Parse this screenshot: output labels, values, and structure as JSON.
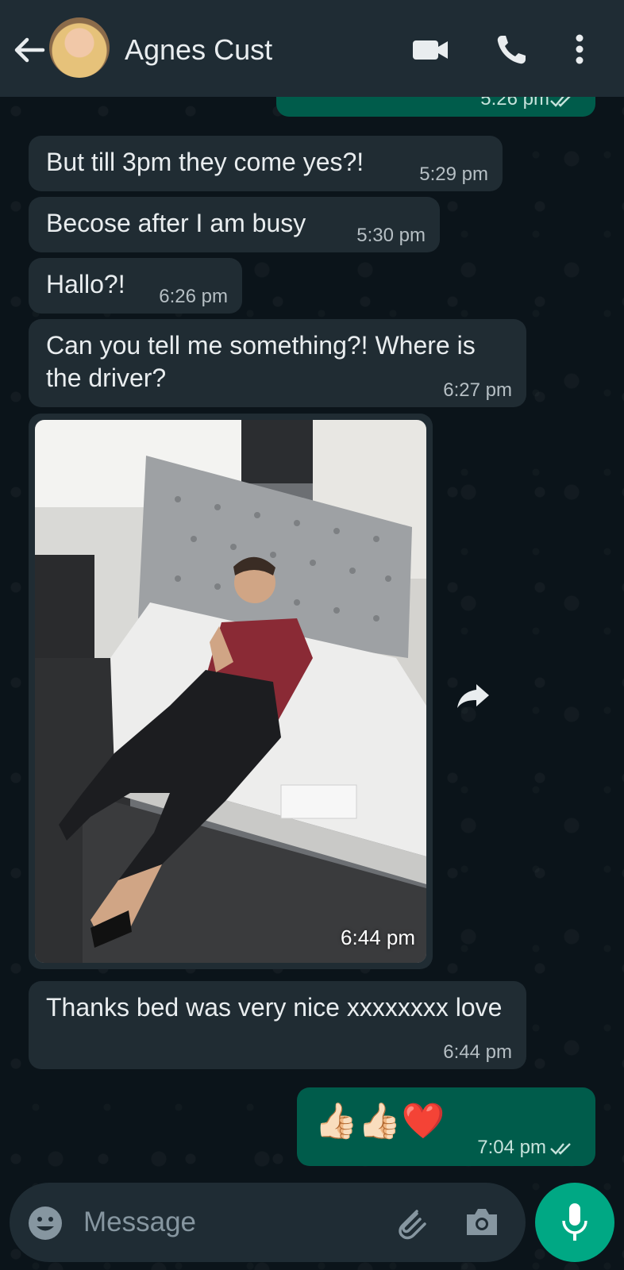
{
  "header": {
    "contact_name": "Agnes Cust",
    "icons": [
      "back-arrow-icon",
      "video-call-icon",
      "voice-call-icon",
      "more-options-icon"
    ]
  },
  "messages": [
    {
      "direction": "outgoing",
      "text": "",
      "time": "5:26 pm",
      "read": true
    },
    {
      "direction": "incoming",
      "text": "But till 3pm they come yes?!",
      "time": "5:29 pm"
    },
    {
      "direction": "incoming",
      "text": "Becose after I am busy",
      "time": "5:30 pm"
    },
    {
      "direction": "incoming",
      "text": "Hallo?!",
      "time": "6:26 pm"
    },
    {
      "direction": "incoming",
      "text": "Can you tell me something?! Where is the driver?",
      "time": "6:27 pm"
    },
    {
      "direction": "incoming",
      "type": "photo",
      "time": "6:44 pm"
    },
    {
      "direction": "incoming",
      "text": "Thanks bed was very nice xxxxxxxx love",
      "time": "6:44 pm"
    },
    {
      "direction": "outgoing",
      "text": "👍🏻👍🏻❤️",
      "time": "7:04 pm",
      "read": true
    }
  ],
  "composer": {
    "placeholder": "Message",
    "icons": [
      "emoji-icon",
      "attach-icon",
      "camera-icon",
      "mic-icon"
    ]
  },
  "colors": {
    "background": "#0b141a",
    "header": "#1f2c34",
    "incoming_bubble": "#202c33",
    "outgoing_bubble": "#005c4b",
    "accent": "#00a884"
  }
}
